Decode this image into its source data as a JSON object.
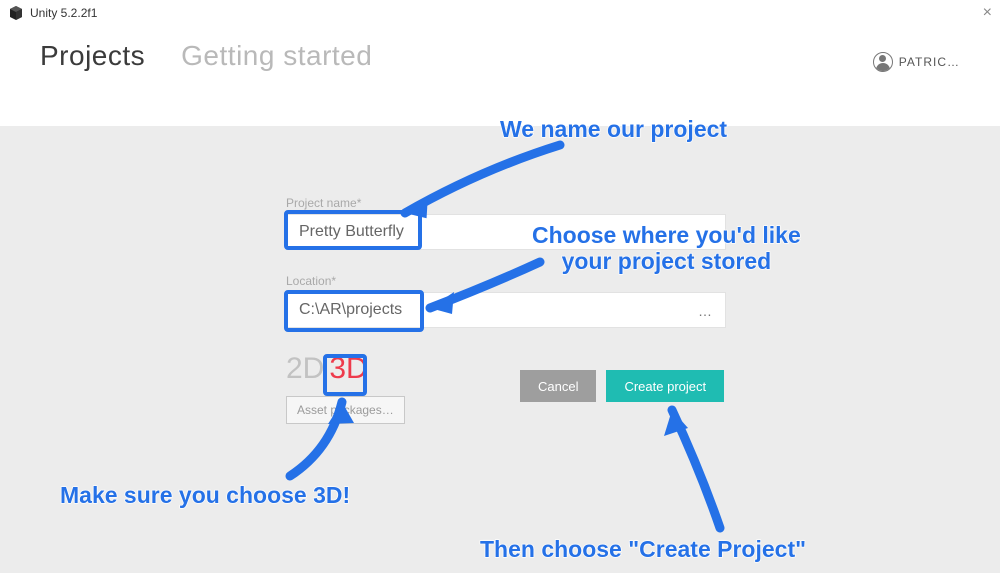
{
  "window": {
    "title": "Unity 5.2.2f1"
  },
  "tabs": {
    "projects": "Projects",
    "getting_started": "Getting started"
  },
  "user": {
    "name": "PATRIC…"
  },
  "form": {
    "project_name_label": "Project name*",
    "project_name_value": "Pretty Butterfly",
    "location_label": "Location*",
    "location_value": "C:\\AR\\projects",
    "location_browse": "…",
    "mode_2d": "2D",
    "mode_3d": "3D",
    "asset_packages": "Asset packages…",
    "cancel": "Cancel",
    "create": "Create project"
  },
  "annotations": {
    "name": "We name our project",
    "location_l1": "Choose where you'd like",
    "location_l2": "your project stored",
    "mode": "Make sure you choose 3D!",
    "create": "Then choose \"Create Project\""
  }
}
